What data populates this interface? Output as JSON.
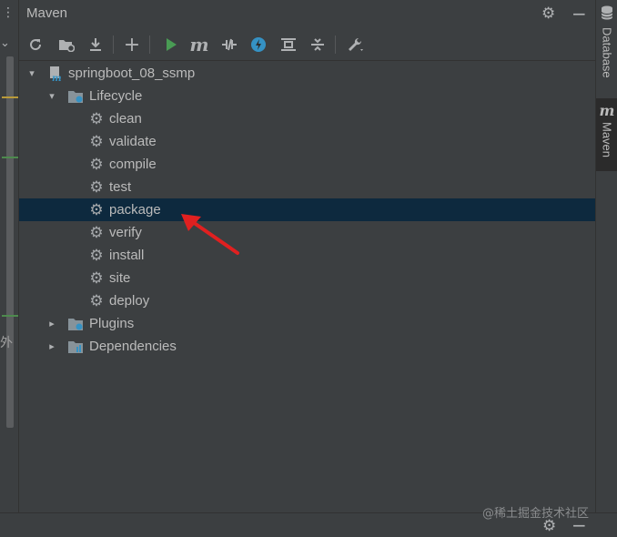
{
  "panel": {
    "title": "Maven"
  },
  "header_icons": {
    "settings": "gear-icon",
    "minimize": "minimize-icon"
  },
  "toolbar": {
    "buttons": [
      {
        "name": "reload-icon",
        "tooltip": "Reload All Maven Projects"
      },
      {
        "name": "generate-sources-icon"
      },
      {
        "name": "download-icon"
      },
      {
        "name": "add-icon"
      },
      {
        "name": "run-icon"
      },
      {
        "name": "execute-goal-icon"
      },
      {
        "name": "toggle-offline-icon"
      },
      {
        "name": "skip-tests-icon"
      },
      {
        "name": "show-dependencies-icon"
      },
      {
        "name": "collapse-all-icon"
      },
      {
        "name": "settings-wrench-icon"
      }
    ]
  },
  "tree": {
    "project": "springboot_08_ssmp",
    "lifecycle": {
      "label": "Lifecycle",
      "goals": [
        "clean",
        "validate",
        "compile",
        "test",
        "package",
        "verify",
        "install",
        "site",
        "deploy"
      ]
    },
    "plugins": "Plugins",
    "dependencies": "Dependencies",
    "selected": "package"
  },
  "right_stripe": {
    "database": "Database",
    "maven": "Maven"
  },
  "left_strip": {
    "text": "外"
  },
  "watermark": "@稀土掘金技术社区",
  "colors": {
    "background": "#3c3f41",
    "selected_row": "#0d293e",
    "run_green": "#499c54",
    "accent_blue": "#3592c4",
    "arrow_red": "#e02020"
  }
}
